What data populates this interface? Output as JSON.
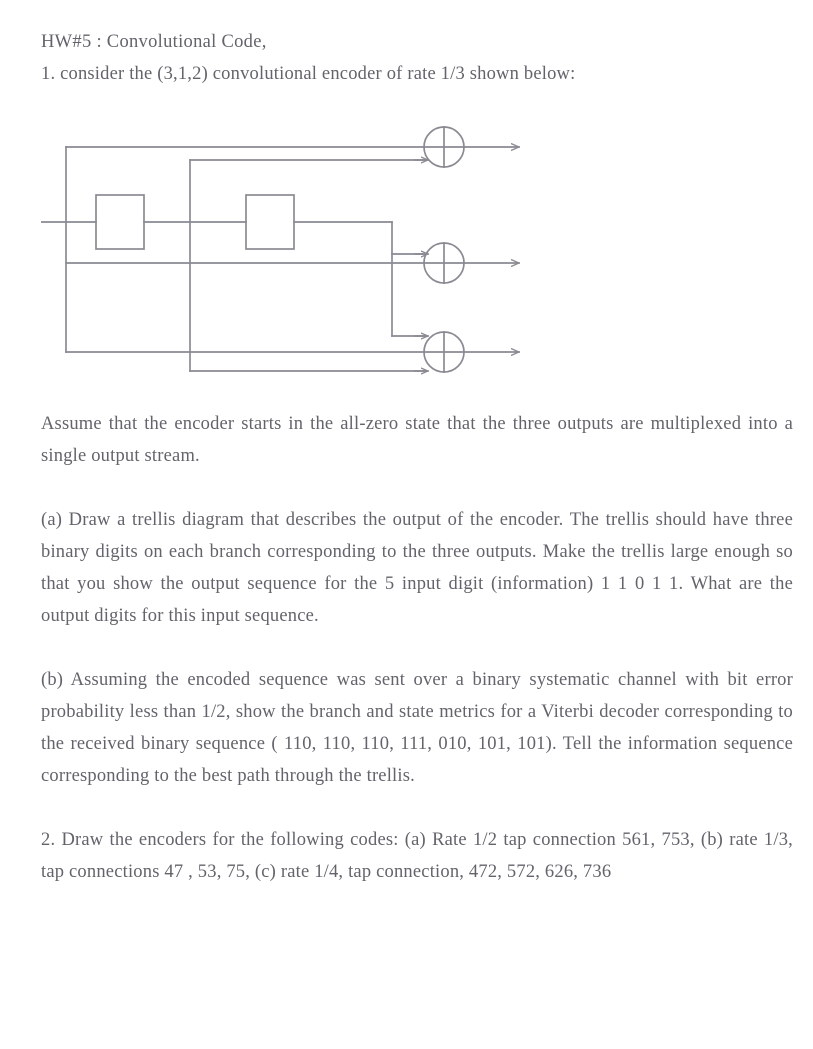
{
  "document": {
    "title_line": "HW#5 : Convolutional Code,",
    "intro_paragraph": "1. consider the (3,1,2) convolutional encoder of rate 1/3 shown below:",
    "assume_paragraph": "Assume that the encoder starts in the all-zero state that the three outputs are multiplexed into a single output stream.",
    "part_a_paragraph": "(a) Draw a trellis diagram that describes the output of the encoder. The trellis should have three binary digits on each branch corresponding to the three outputs. Make the trellis large enough so that you show the output sequence for the 5 input digit (information) 1 1 0 1 1. What are the output digits for this input sequence.",
    "part_b_paragraph": "(b) Assuming the encoded sequence was sent over a binary systematic channel with bit error probability less than 1/2, show the branch and state metrics for a Viterbi decoder corresponding to the received binary sequence ( 110, 110, 110, 111, 010, 101, 101). Tell the information sequence corresponding to the best path through the trellis.",
    "question_2_paragraph": "2. Draw the encoders for the following codes: (a) Rate 1/2 tap connection 561, 753, (b) rate 1/3, tap connections 47 , 53, 75, (c) rate 1/4, tap connection, 472, 572, 626, 736"
  },
  "figure": {
    "caption": "",
    "description": "(3,1,2) convolutional encoder block diagram",
    "line_color": "#8a8a92",
    "element_names": {
      "delay_1": "delay-box-1",
      "delay_2": "delay-box-2",
      "adder_1": "xor-adder-output-1",
      "adder_2": "xor-adder-output-2",
      "adder_3": "xor-adder-output-3"
    },
    "delay_boxes": [
      "",
      ""
    ],
    "adder_symbol": "+",
    "num_delay_boxes": 2,
    "num_adders": 3,
    "num_outputs": 3
  }
}
